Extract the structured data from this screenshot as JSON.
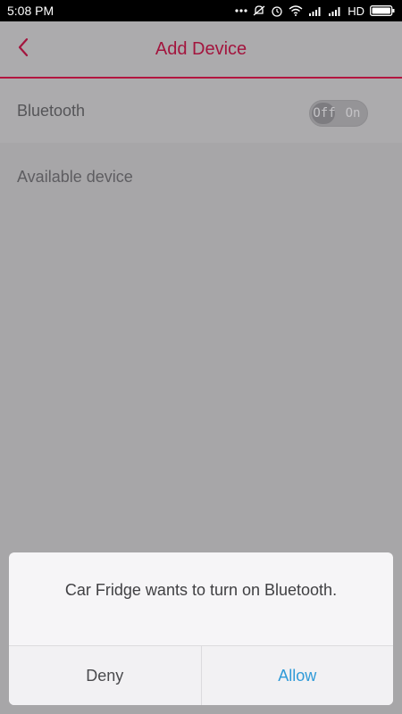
{
  "status_bar": {
    "time": "5:08 PM",
    "network_label": "HD",
    "icons": [
      "more-dots-icon",
      "mute-icon",
      "alarm-icon",
      "wifi-icon",
      "signal-icon",
      "signal-icon",
      "battery-icon"
    ]
  },
  "header": {
    "title": "Add Device",
    "back_icon": "chevron-left-icon",
    "accent_color": "#a3153e"
  },
  "bluetooth": {
    "label": "Bluetooth",
    "toggle_off_label": "Off",
    "toggle_on_label": "On",
    "state": "off"
  },
  "devices": {
    "section_label": "Available device"
  },
  "dialog": {
    "message": "Car Fridge wants to turn on Bluetooth.",
    "deny_label": "Deny",
    "allow_label": "Allow",
    "allow_color": "#2f9ad8"
  }
}
